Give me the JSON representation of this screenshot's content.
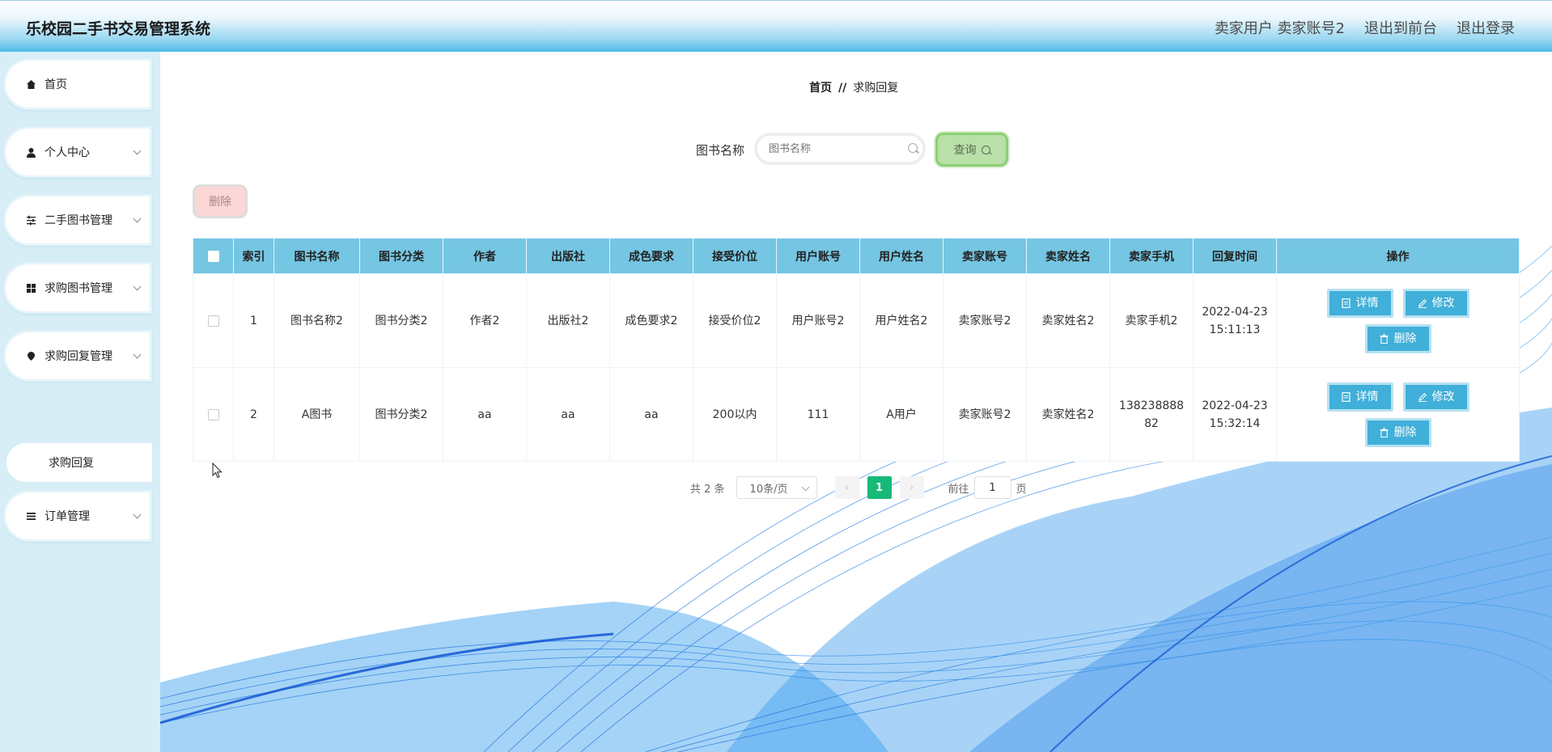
{
  "header": {
    "title": "乐校园二手书交易管理系统",
    "user_role": "卖家用户",
    "user_name": "卖家账号2",
    "to_front": "退出到前台",
    "logout": "退出登录"
  },
  "sidebar": {
    "items": [
      {
        "label": "首页",
        "icon": "home-icon"
      },
      {
        "label": "个人中心",
        "icon": "user-icon"
      },
      {
        "label": "二手图书管理",
        "icon": "sliders-icon"
      },
      {
        "label": "求购图书管理",
        "icon": "grid-icon"
      },
      {
        "label": "求购回复管理",
        "icon": "pin-icon"
      },
      {
        "label": "订单管理",
        "icon": "list-icon"
      }
    ],
    "submenu": "求购回复"
  },
  "breadcrumb": {
    "home": "首页",
    "separator": "//",
    "current": "求购回复"
  },
  "search": {
    "label": "图书名称",
    "placeholder": "图书名称",
    "button": "查询"
  },
  "actions": {
    "delete": "删除"
  },
  "table": {
    "columns": [
      "索引",
      "图书名称",
      "图书分类",
      "作者",
      "出版社",
      "成色要求",
      "接受价位",
      "用户账号",
      "用户姓名",
      "卖家账号",
      "卖家姓名",
      "卖家手机",
      "回复时间",
      "操作"
    ],
    "rows": [
      {
        "index": "1",
        "book_name": "图书名称2",
        "category": "图书分类2",
        "author": "作者2",
        "publisher": "出版社2",
        "condition": "成色要求2",
        "price": "接受价位2",
        "user_account": "用户账号2",
        "user_name": "用户姓名2",
        "seller_account": "卖家账号2",
        "seller_name": "卖家姓名2",
        "seller_phone": "卖家手机2",
        "reply_time": "2022-04-23 15:11:13"
      },
      {
        "index": "2",
        "book_name": "A图书",
        "category": "图书分类2",
        "author": "aa",
        "publisher": "aa",
        "condition": "aa",
        "price": "200以内",
        "user_account": "111",
        "user_name": "A用户",
        "seller_account": "卖家账号2",
        "seller_name": "卖家姓名2",
        "seller_phone": "13823888882",
        "reply_time": "2022-04-23 15:32:14"
      }
    ],
    "row_actions": {
      "detail": "详情",
      "edit": "修改",
      "delete": "删除"
    }
  },
  "pagination": {
    "total": "共 2 条",
    "page_size": "10条/页",
    "current_page": "1",
    "goto_prefix": "前往",
    "goto_value": "1",
    "goto_suffix": "页"
  },
  "colors": {
    "header_accent": "#4fb9e6",
    "table_header": "#75c6e2",
    "action_button": "#40afd9",
    "query_button": "#b8e0a8",
    "delete_button": "#fbd7d6",
    "page_active": "#17b978"
  }
}
